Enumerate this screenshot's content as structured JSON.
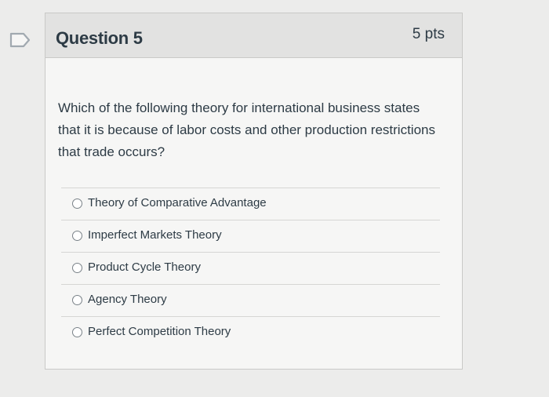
{
  "question": {
    "title": "Question 5",
    "points": "5 pts",
    "text": "Which of the following theory for international business states that it is because of labor costs and other production restrictions that trade occurs?",
    "answers": [
      "Theory of Comparative Advantage",
      "Imperfect Markets Theory",
      "Product Cycle Theory",
      "Agency Theory",
      "Perfect Competition Theory"
    ]
  },
  "icons": {
    "flag": "flag-outline-icon"
  },
  "colors": {
    "text": "#2d3b45",
    "header_bg": "#e2e2e1",
    "card_bg": "#f6f6f5",
    "flag_stroke": "#a1a9b0"
  }
}
